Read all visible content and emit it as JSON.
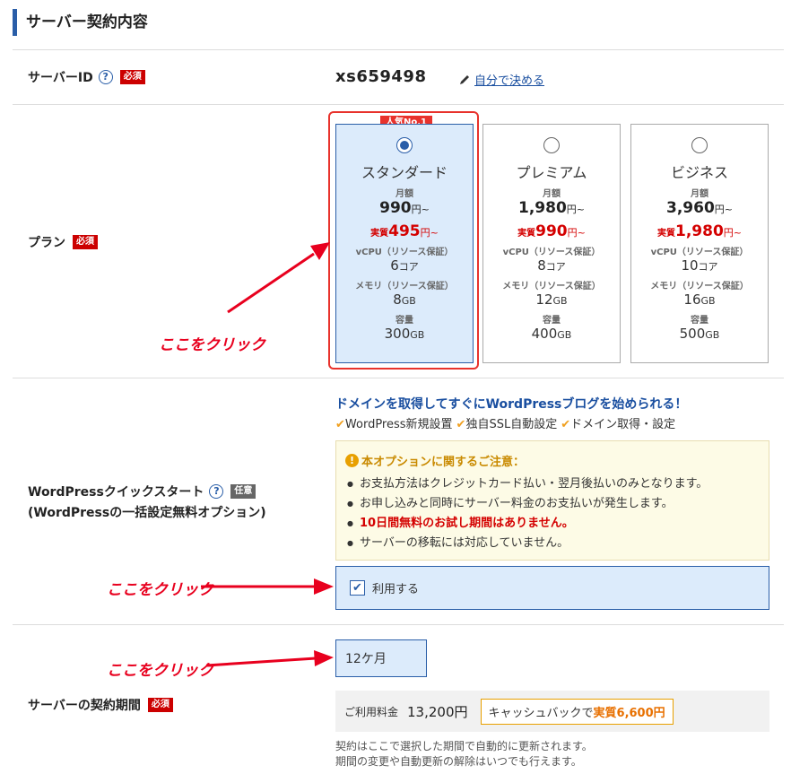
{
  "section_title": "サーバー契約内容",
  "server_id": {
    "label": "サーバーID",
    "help": "?",
    "badge": "必須",
    "value": "xs659498",
    "link": "自分で決める"
  },
  "plan": {
    "label": "プラン",
    "badge": "必須",
    "popular_tag": "人気No.1",
    "monthly_label": "月額",
    "real_prefix": "実質",
    "yen_from": "円~",
    "cpu_label": "vCPU（リソース保証）",
    "mem_label": "メモリ（リソース保証）",
    "disk_label": "容量",
    "core_unit": "コア",
    "gb_unit": "GB",
    "items": [
      {
        "name": "スタンダード",
        "price": "990",
        "real": "495",
        "cpu": "6",
        "mem": "8",
        "disk": "300",
        "selected": true
      },
      {
        "name": "プレミアム",
        "price": "1,980",
        "real": "990",
        "cpu": "8",
        "mem": "12",
        "disk": "400",
        "selected": false
      },
      {
        "name": "ビジネス",
        "price": "3,960",
        "real": "1,980",
        "cpu": "10",
        "mem": "16",
        "disk": "500",
        "selected": false
      }
    ]
  },
  "annotations": {
    "click1": "ここをクリック",
    "click2": "ここをクリック",
    "click3": "ここをクリック"
  },
  "wp": {
    "label1": "WordPressクイックスタート",
    "help": "?",
    "badge": "任意",
    "label2": "(WordPressの一括設定無料オプション)",
    "headline": "ドメインを取得してすぐにWordPressブログを始められる！",
    "features": [
      "WordPress新規設置",
      "独自SSL自動設定",
      "ドメイン取得・設定"
    ],
    "check_mark": "✔",
    "caution_icon": "!",
    "caution_title": "本オプションに関するご注意：",
    "cautions": [
      "お支払方法はクレジットカード払い・翌月後払いのみとなります。",
      "お申し込みと同時にサーバー料金のお支払いが発生します。",
      "10日間無料のお試し期間はありません。",
      "サーバーの移転には対応していません。"
    ],
    "use_label": "利用する",
    "use_checked_mark": "✔"
  },
  "period": {
    "label": "サーバーの契約期間",
    "badge": "必須",
    "selected": "12ケ月",
    "fee_label": "ご利用料金",
    "fee_amount": "13,200円",
    "cashback_pre": "キャッシュバックで",
    "cashback_amt": "実質6,600円",
    "note1": "契約はここで選択した期間で自動的に更新されます。",
    "note2": "期間の変更や自動更新の解除はいつでも行えます。"
  },
  "colors": {
    "accent": "#2a5ea8",
    "alert": "#e8322c",
    "selected_bg": "#dcebfb"
  }
}
